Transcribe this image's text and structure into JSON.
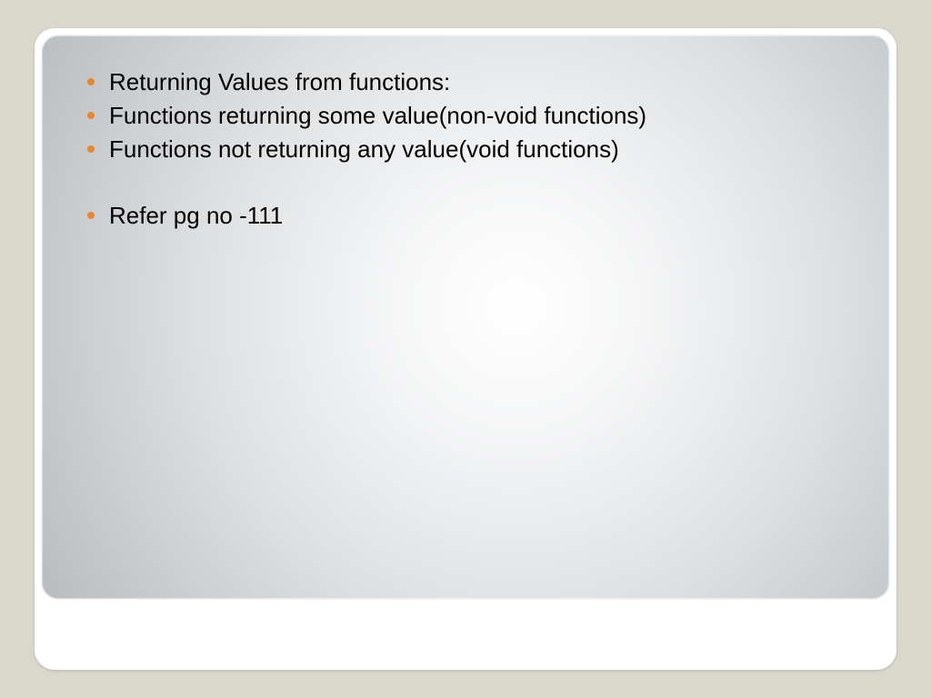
{
  "slide": {
    "bullets": [
      "Returning Values from functions:",
      "Functions returning some value(non-void functions)",
      "Functions not returning any value(void functions)"
    ],
    "bullets2": [
      "Refer pg no -111"
    ]
  }
}
